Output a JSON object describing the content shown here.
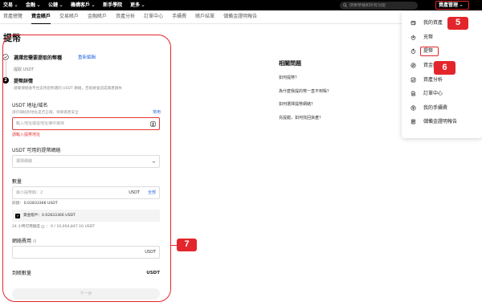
{
  "topnav": {
    "items": [
      {
        "label": "交易",
        "has_dropdown": true
      },
      {
        "label": "金融",
        "has_dropdown": true
      },
      {
        "label": "公鏈",
        "has_dropdown": true
      },
      {
        "label": "機構客戶",
        "has_dropdown": true
      },
      {
        "label": "新手學院",
        "has_dropdown": false
      },
      {
        "label": "更多",
        "has_dropdown": true
      }
    ],
    "search_icon": "search-icon",
    "search_placeholder": "搜索幣種和所有功能",
    "asset_menu_label": "資產管理",
    "asset_menu_open": true
  },
  "tabs": [
    {
      "label": "資產總覽",
      "active": false
    },
    {
      "label": "資金賬戶",
      "active": true
    },
    {
      "label": "交易賬戶",
      "active": false
    },
    {
      "label": "金融賬戶",
      "active": false
    },
    {
      "label": "資產分析",
      "active": false
    },
    {
      "label": "訂單中心",
      "active": false
    },
    {
      "label": "手續費",
      "active": false
    },
    {
      "label": "賬戶結單",
      "active": false
    },
    {
      "label": "儲備金證明報告",
      "active": false
    }
  ],
  "withdraw": {
    "title": "提幣",
    "step1": {
      "icon": "check-circle-icon",
      "title": "選擇您需要提取的幣種",
      "edit_link": "重新編輯",
      "summary": "提取 USDT"
    },
    "step2": {
      "number": "2",
      "title": "提幣詳情",
      "notice": "請確保接收平台支持您所選的 USDT 網絡，否則將會造成資產損失"
    },
    "address": {
      "label": "USDT 地址/域名",
      "hint": "請仔細核對地址是否正確，保障資產安全",
      "side_link": "常用",
      "placeholder": "輸入地址或從地址簿中選擇",
      "icon": "address-book-icon",
      "error": "請輸入提幣地址"
    },
    "network": {
      "label": "USDT 可用的提幣網絡",
      "selected": "選擇網絡",
      "icon": "chevron-down-icon"
    },
    "amount": {
      "label": "數量",
      "placeholder": "最小提幣額：2",
      "unit": "USDT",
      "max_link": "全部",
      "balance_label": "餘額：",
      "balance_value": "0.02833366 USDT",
      "funding_account_checked": true,
      "funding_account_label": "資金賬戶：",
      "funding_account_value": "0.02833366 USDT",
      "daily_limit_label": "24 小時可用額度",
      "daily_limit_separator": "：",
      "daily_limit_value": "0 / 10,004,847.16 USDT"
    },
    "fee": {
      "label": "網絡費用",
      "unit": "USDT"
    },
    "receive": {
      "label": "到賬數量",
      "unit": "USDT"
    },
    "next_button": "下一步"
  },
  "faq": {
    "title": "相關問題",
    "items": [
      "如何提幣？",
      "為什麼我提的幣一直不到賬？",
      "如何選擇提幣網絡？",
      "充提錯，如何找回資產？"
    ]
  },
  "asset_menu": {
    "items": [
      {
        "label": "我的資產",
        "icon": "wallet-icon"
      },
      {
        "label": "充幣",
        "icon": "deposit-icon"
      },
      {
        "label": "提幣",
        "icon": "withdraw-icon"
      },
      {
        "label": "資金劃轉",
        "icon": "transfer-icon"
      },
      {
        "label": "資產分析",
        "icon": "analysis-icon"
      },
      {
        "label": "訂單中心",
        "icon": "order-icon"
      },
      {
        "label": "我的手續費",
        "icon": "fee-icon"
      },
      {
        "label": "儲備金證明報告",
        "icon": "report-icon"
      }
    ]
  },
  "annotations": {
    "badge_5": "5",
    "badge_6": "6",
    "badge_7": "7"
  },
  "colors": {
    "top_bar": "#000000",
    "link_blue": "#2a6de0",
    "error_red": "#e5383b",
    "annotation_red": "#e3262b"
  }
}
